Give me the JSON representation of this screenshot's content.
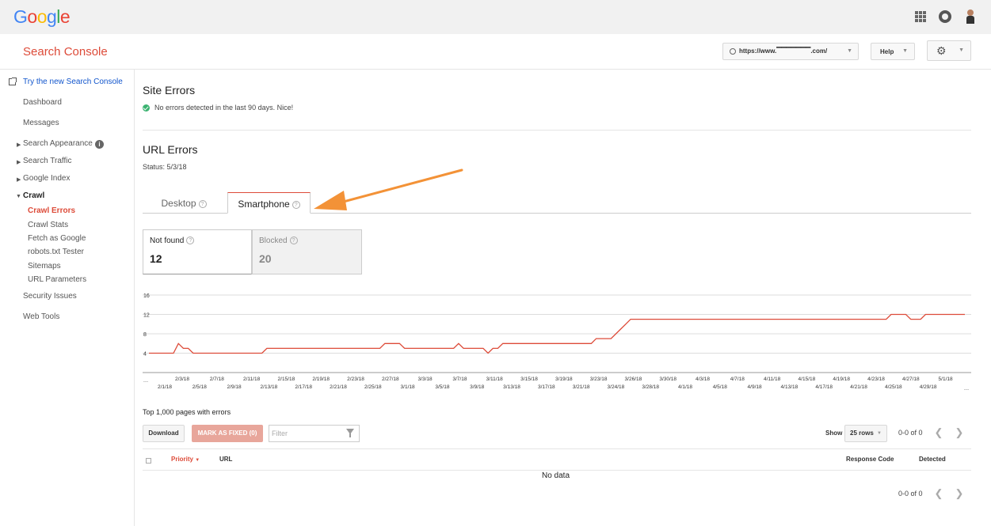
{
  "google": {
    "logo_letters": [
      "G",
      "o",
      "o",
      "g",
      "l",
      "e"
    ],
    "logo_colors": [
      "#4285f4",
      "#ea4335",
      "#fbbc05",
      "#4285f4",
      "#34a853",
      "#ea4335"
    ]
  },
  "header": {
    "title": "Search Console",
    "site": "https://www.▔▔▔▔▔▔▔.com/",
    "help": "Help"
  },
  "sidebar": {
    "try_new": "Try the new Search Console",
    "dashboard": "Dashboard",
    "messages": "Messages",
    "search_appearance": "Search Appearance",
    "search_traffic": "Search Traffic",
    "google_index": "Google Index",
    "crawl": "Crawl",
    "crawl_items": [
      "Crawl Errors",
      "Crawl Stats",
      "Fetch as Google",
      "robots.txt Tester",
      "Sitemaps",
      "URL Parameters"
    ],
    "security": "Security Issues",
    "web_tools": "Web Tools"
  },
  "site_errors": {
    "title": "Site Errors",
    "message": "No errors detected in the last 90 days. Nice!"
  },
  "url_errors": {
    "title": "URL Errors",
    "status": "Status: 5/3/18"
  },
  "tabs": [
    "Desktop",
    "Smartphone"
  ],
  "counts": [
    {
      "label": "Not found",
      "value": "12"
    },
    {
      "label": "Blocked",
      "value": "20"
    }
  ],
  "chart_data": {
    "type": "line",
    "ylim": [
      0,
      16
    ],
    "yticks": [
      "16",
      "12",
      "8",
      "4"
    ],
    "x_start": "…",
    "x_end": "…",
    "xticks_top": [
      "2/3/18",
      "2/7/18",
      "2/11/18",
      "2/15/18",
      "2/19/18",
      "2/23/18",
      "2/27/18",
      "3/3/18",
      "3/7/18",
      "3/11/18",
      "3/15/18",
      "3/19/18",
      "3/23/18",
      "3/26/18",
      "3/30/18",
      "4/3/18",
      "4/7/18",
      "4/11/18",
      "4/15/18",
      "4/19/18",
      "4/23/18",
      "4/27/18",
      "5/1/18"
    ],
    "xticks_bottom": [
      "2/1/18",
      "2/5/18",
      "2/9/18",
      "2/13/18",
      "2/17/18",
      "2/21/18",
      "2/25/18",
      "3/1/18",
      "3/5/18",
      "3/9/18",
      "3/13/18",
      "3/17/18",
      "3/21/18",
      "3/24/18",
      "3/28/18",
      "4/1/18",
      "4/5/18",
      "4/9/18",
      "4/13/18",
      "4/17/18",
      "4/21/18",
      "4/25/18",
      "4/29/18"
    ],
    "series": [
      {
        "color": "#dd4b39",
        "values": [
          4,
          4,
          4,
          4,
          4,
          4,
          6,
          5,
          5,
          4,
          4,
          4,
          4,
          4,
          4,
          4,
          4,
          4,
          4,
          4,
          4,
          4,
          4,
          4,
          5,
          5,
          5,
          5,
          5,
          5,
          5,
          5,
          5,
          5,
          5,
          5,
          5,
          5,
          5,
          5,
          5,
          5,
          5,
          5,
          5,
          5,
          5,
          5,
          6,
          6,
          6,
          6,
          5,
          5,
          5,
          5,
          5,
          5,
          5,
          5,
          5,
          5,
          5,
          6,
          5,
          5,
          5,
          5,
          5,
          4,
          5,
          5,
          6,
          6,
          6,
          6,
          6,
          6,
          6,
          6,
          6,
          6,
          6,
          6,
          6,
          6,
          6,
          6,
          6,
          6,
          6,
          7,
          7,
          7,
          7,
          8,
          9,
          10,
          11,
          11,
          11,
          11,
          11,
          11,
          11,
          11,
          11,
          11,
          11,
          11,
          11,
          11,
          11,
          11,
          11,
          11,
          11,
          11,
          11,
          11,
          11,
          11,
          11,
          11,
          11,
          11,
          11,
          11,
          11,
          11,
          11,
          11,
          11,
          11,
          11,
          11,
          11,
          11,
          11,
          11,
          11,
          11,
          11,
          11,
          11,
          11,
          11,
          11,
          11,
          11,
          11,
          12,
          12,
          12,
          12,
          11,
          11,
          11,
          12,
          12,
          12,
          12,
          12,
          12,
          12,
          12,
          12
        ]
      }
    ]
  },
  "table": {
    "caption": "Top 1,000 pages with errors",
    "download": "Download",
    "mark_fixed": "MARK AS FIXED (0)",
    "filter_placeholder": "Filter",
    "show": "Show",
    "rows": "25 rows",
    "range": "0-0 of 0",
    "columns": {
      "priority": "Priority",
      "url": "URL",
      "response": "Response Code",
      "detected": "Detected"
    },
    "empty": "No data"
  }
}
